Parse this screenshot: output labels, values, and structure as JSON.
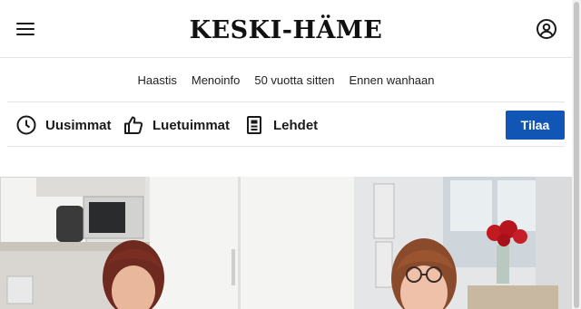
{
  "header": {
    "logo": "KESKI-HÄME",
    "menu_icon": "hamburger-menu-icon",
    "account_icon": "user-account-icon"
  },
  "subnav": {
    "items": [
      "Haastis",
      "Menoinfo",
      "50 vuotta sitten",
      "Ennen wanhaan"
    ]
  },
  "toolbar": {
    "items": [
      {
        "label": "Uusimmat",
        "icon": "clock-icon"
      },
      {
        "label": "Luetuimmat",
        "icon": "thumbs-up-icon"
      },
      {
        "label": "Lehdet",
        "icon": "newspaper-icon"
      }
    ],
    "subscribe_label": "Tilaa"
  },
  "colors": {
    "accent": "#1256b5",
    "text": "#1a1a1a",
    "divider": "#e4e4e4"
  }
}
